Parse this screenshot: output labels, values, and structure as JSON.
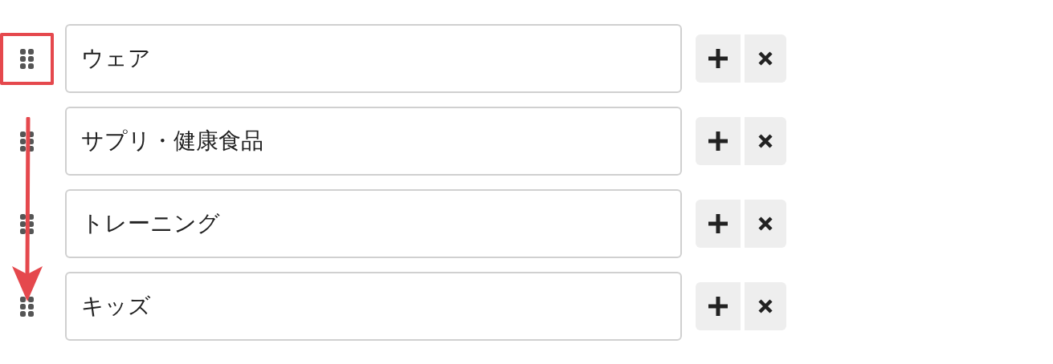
{
  "items": [
    {
      "label": "ウェア",
      "highlighted": true
    },
    {
      "label": "サプリ・健康食品",
      "highlighted": false
    },
    {
      "label": "トレーニング",
      "highlighted": false
    },
    {
      "label": "キッズ",
      "highlighted": false
    }
  ],
  "annotations": [
    {
      "kind": "arrow"
    }
  ]
}
